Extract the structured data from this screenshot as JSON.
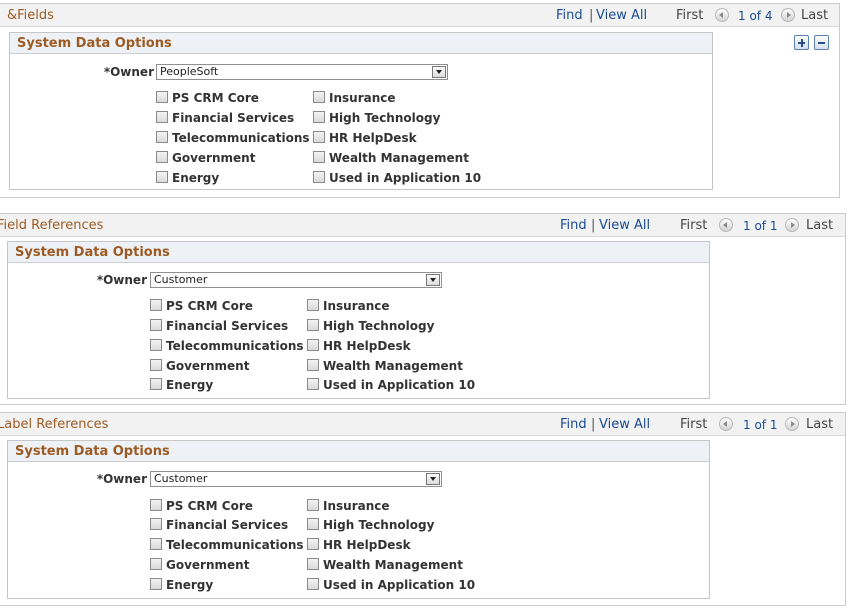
{
  "checkbox_labels": {
    "ps_crm_core": "PS CRM Core",
    "financial_services": "Financial Services",
    "telecommunications": "Telecommunications",
    "government": "Government",
    "energy": "Energy",
    "insurance": "Insurance",
    "high_technology": "High Technology",
    "hr_helpdesk": "HR HelpDesk",
    "wealth_management": "Wealth Management",
    "used_in_application_10": "Used in Application 10"
  },
  "nav": {
    "find": "Find",
    "separator": "|",
    "view_all": "View All",
    "first": "First",
    "last": "Last"
  },
  "sections": [
    {
      "title": "&Fields",
      "count": "1 of 4",
      "group_title": "System Data Options",
      "owner_label": "*Owner",
      "owner_value": "PeopleSoft"
    },
    {
      "title": "Field References",
      "count": "1 of 1",
      "group_title": "System Data Options",
      "owner_label": "*Owner",
      "owner_value": "Customer"
    },
    {
      "title": "Label References",
      "count": "1 of 1",
      "group_title": "System Data Options",
      "owner_label": "*Owner",
      "owner_value": "Customer"
    }
  ],
  "colors": {
    "section_title": "#9c5b24",
    "link": "#1a4b93",
    "header_bg": "#f2f2f2"
  }
}
